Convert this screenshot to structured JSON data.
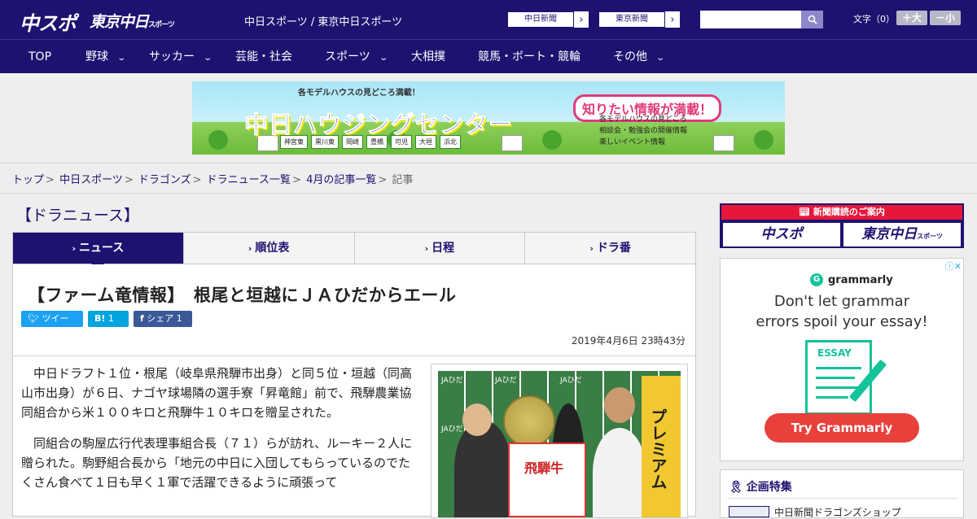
{
  "header": {
    "logo_chuspo": "中スポ",
    "logo_tokyo": "東京中日",
    "logo_tokyo_sub": "スポーツ",
    "site_title": "中日スポーツ / 東京中日スポーツ",
    "paper_links": [
      {
        "label": "中日新聞"
      },
      {
        "label": "東京新聞"
      }
    ],
    "search_placeholder": "",
    "font_size_label": "文字（0）",
    "font_up": "＋大",
    "font_down": "－小"
  },
  "nav": {
    "items": [
      {
        "label": "TOP",
        "dropdown": false
      },
      {
        "label": "野球",
        "dropdown": true
      },
      {
        "label": "サッカー",
        "dropdown": true
      },
      {
        "label": "芸能・社会",
        "dropdown": false
      },
      {
        "label": "スポーツ",
        "dropdown": true
      },
      {
        "label": "大相撲",
        "dropdown": false
      },
      {
        "label": "競馬・ボート・競輪",
        "dropdown": false
      },
      {
        "label": "その他",
        "dropdown": true
      }
    ]
  },
  "ad_banner": {
    "top_text": "各モデルハウスの見どころ満載！",
    "main_text": "中日ハウジングセンター",
    "right_badge": "知りたい情報が満載！",
    "list": [
      "各モデルハウスの見どころ",
      "相談会・勉強会の開催情報",
      "楽しいイベント情報"
    ],
    "cities": [
      "神宮東",
      "黒川東",
      "岡崎",
      "豊橋",
      "可児",
      "大垣",
      "浜北"
    ]
  },
  "breadcrumb": {
    "items": [
      "トップ",
      "中日スポーツ",
      "ドラゴンズ",
      "ドラニュース一覧",
      "4月の記事一覧"
    ],
    "current": "記事",
    "separator": ">"
  },
  "main": {
    "section_title": "【ドラニュース】",
    "tabs": [
      {
        "label": "ニュース",
        "active": true
      },
      {
        "label": "順位表",
        "active": false
      },
      {
        "label": "日程",
        "active": false
      },
      {
        "label": "ドラ番",
        "active": false
      }
    ],
    "article": {
      "headline": "【ファーム竜情報】　根尾と垣越にＪＡひだからエール",
      "share": {
        "tweet": "ツイート",
        "hatena_count": "1",
        "facebook": "シェア",
        "facebook_count": "1"
      },
      "date": "2019年4月6日 23時43分",
      "paragraphs": [
        "中日ドラフト１位・根尾（岐阜県飛騨市出身）と同５位・垣越（同高山市出身）が６日、ナゴヤ球場隣の選手寮「昇竜館」前で、飛騨農業協同組合から米１００キロと飛騨牛１０キロを贈呈された。",
        "同組合の駒屋広行代表理事組合長（７１）らが訪れ、ルーキー２人に贈られた。駒野組合長から「地元の中日に入団してもらっているのでたくさん食べて１日も早く１軍で活躍できるように頑張って"
      ],
      "photo": {
        "ja_label": "JAひだ",
        "board_text": "プレミアム",
        "box_text": "飛騨牛"
      }
    }
  },
  "sidebar": {
    "subscribe": {
      "header": "新聞購読のご案内",
      "logo_chuspo": "中スポ",
      "logo_tokyo": "東京中日",
      "logo_tokyo_sub": "スポーツ"
    },
    "ad": {
      "brand": "grammarly",
      "line1": "Don't let grammar",
      "line2": "errors spoil your essay!",
      "essay_label": "ESSAY",
      "button": "Try Grammarly"
    },
    "feature": {
      "title": "企画特集",
      "item": "中日新聞ドラゴンズショップ"
    }
  }
}
